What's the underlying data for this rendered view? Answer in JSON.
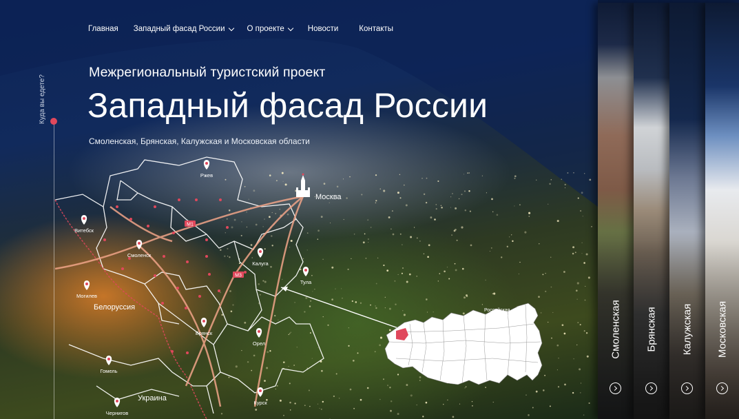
{
  "nav": {
    "items": [
      {
        "label": "Главная"
      },
      {
        "label": "Западный фасад России",
        "has_dropdown": true
      },
      {
        "label": "О проекте",
        "has_dropdown": true
      },
      {
        "label": "Новости"
      },
      {
        "label": "Контакты"
      }
    ]
  },
  "hero": {
    "subtitle": "Межрегиональный туристский проект",
    "title": "Западный фасад России",
    "regions_line": "Смоленская, Брянская, Калужская  и Московская области",
    "side_question": "Куда вы едете?"
  },
  "map": {
    "cities": [
      {
        "name": "Ржев"
      },
      {
        "name": "Витебск"
      },
      {
        "name": "Смоленск"
      },
      {
        "name": "Калуга"
      },
      {
        "name": "Тула"
      },
      {
        "name": "Могилев"
      },
      {
        "name": "Брянск"
      },
      {
        "name": "Орел"
      },
      {
        "name": "Гомель"
      },
      {
        "name": "Чернигов"
      },
      {
        "name": "Курск"
      }
    ],
    "capital": "Москва",
    "countries": {
      "belarus": "Белоруссия",
      "ukraine": "Украина"
    },
    "roads": {
      "m1": "М1",
      "m3": "М3"
    },
    "inset_label_line1": "Российская",
    "inset_label_line2": "Федерация",
    "accent_color": "#e0485c"
  },
  "region_cards": [
    {
      "name": "Смоленская"
    },
    {
      "name": "Брянская"
    },
    {
      "name": "Калужская"
    },
    {
      "name": "Московская"
    }
  ]
}
